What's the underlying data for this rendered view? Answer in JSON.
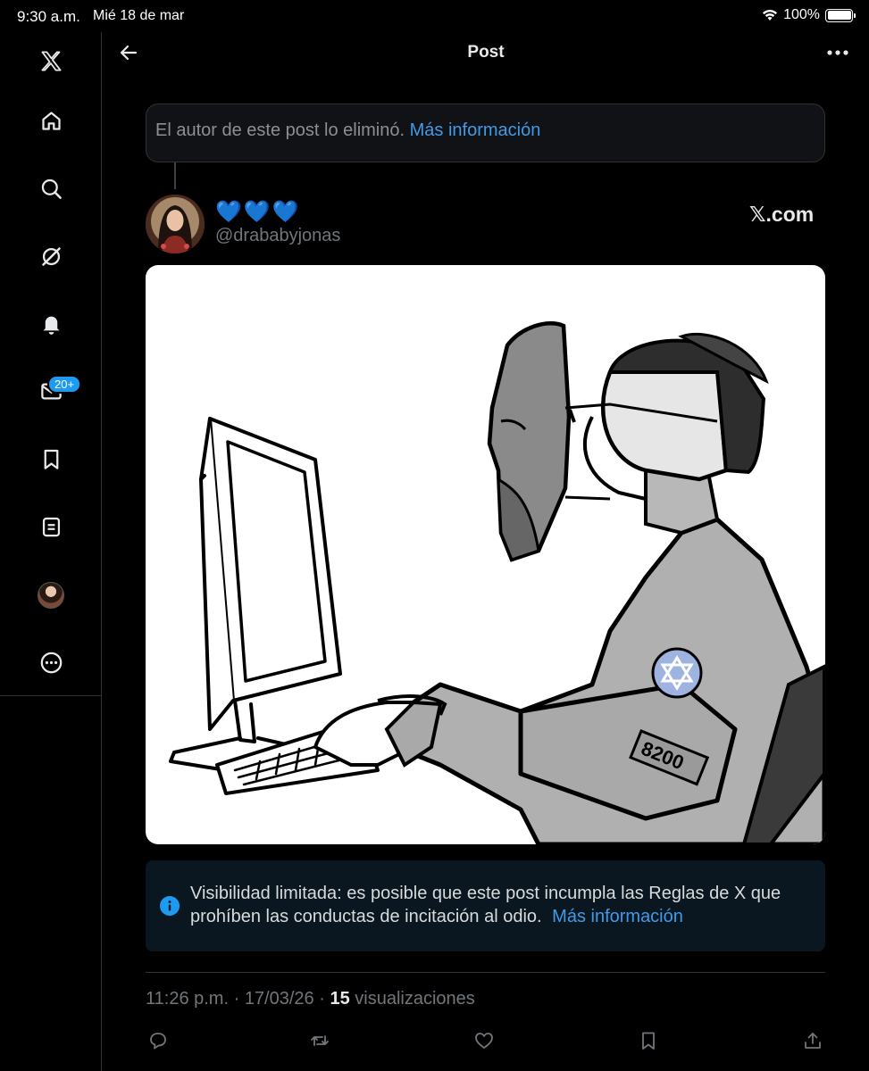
{
  "status_bar": {
    "time": "9:30 a.m.",
    "date": "Mié 18 de mar",
    "battery": "100%"
  },
  "sidebar": {
    "items": [
      {
        "name": "x-logo",
        "icon": "x-logo-icon"
      },
      {
        "name": "home",
        "icon": "home-icon"
      },
      {
        "name": "search",
        "icon": "search-icon"
      },
      {
        "name": "grok",
        "icon": "grok-icon"
      },
      {
        "name": "notifications",
        "icon": "bell-icon"
      },
      {
        "name": "messages",
        "icon": "mail-icon",
        "badge": "20+"
      },
      {
        "name": "bookmarks",
        "icon": "bookmark-icon"
      },
      {
        "name": "lists",
        "icon": "list-icon"
      },
      {
        "name": "profile",
        "icon": "avatar"
      },
      {
        "name": "more",
        "icon": "more-circle-icon"
      }
    ]
  },
  "header": {
    "title": "Post"
  },
  "deleted_notice": {
    "text": "El autor de este post lo eliminó.",
    "link": "Más información"
  },
  "author": {
    "display_name": "💙💙💙",
    "handle": "@drababyjonas",
    "source": "𝕏.com"
  },
  "image": {
    "badge_text": "8200"
  },
  "limited_notice": {
    "text": "Visibilidad limitada: es posible que este post incumpla las Reglas de X que prohíben las conductas de incitación al odio.",
    "link": "Más información"
  },
  "meta": {
    "time": "11:26 p.m.",
    "date": "17/03/26",
    "views_count": "15",
    "views_label": "visualizaciones"
  },
  "colors": {
    "accent": "#1d9bf0",
    "link": "#3f9ae8",
    "background": "#000000"
  }
}
